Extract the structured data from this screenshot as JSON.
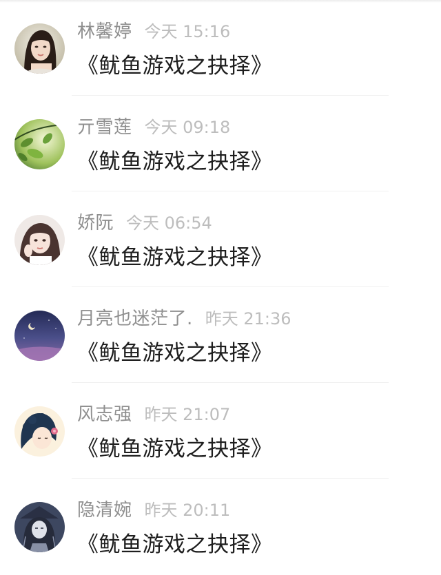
{
  "comments": [
    {
      "username": "林馨婷",
      "time": "今天 15:16",
      "content": "《鱿鱼游戏之抉择》",
      "avatar": "woman-portrait-avatar"
    },
    {
      "username": "亓雪莲",
      "time": "今天 09:18",
      "content": "《鱿鱼游戏之抉择》",
      "avatar": "green-leaves-avatar"
    },
    {
      "username": "娇阮",
      "time": "今天 06:54",
      "content": "《鱿鱼游戏之抉择》",
      "avatar": "girl-selfie-avatar"
    },
    {
      "username": "月亮也迷茫了.",
      "time": "昨天 21:36",
      "content": "《鱿鱼游戏之抉择》",
      "avatar": "night-sky-moon-avatar"
    },
    {
      "username": "风志强",
      "time": "昨天 21:07",
      "content": "《鱿鱼游戏之抉择》",
      "avatar": "anime-girl-flower-avatar"
    },
    {
      "username": "隐清婉",
      "time": "昨天 20:11",
      "content": "《鱿鱼游戏之抉择》",
      "avatar": "dark-anime-character-avatar"
    }
  ]
}
